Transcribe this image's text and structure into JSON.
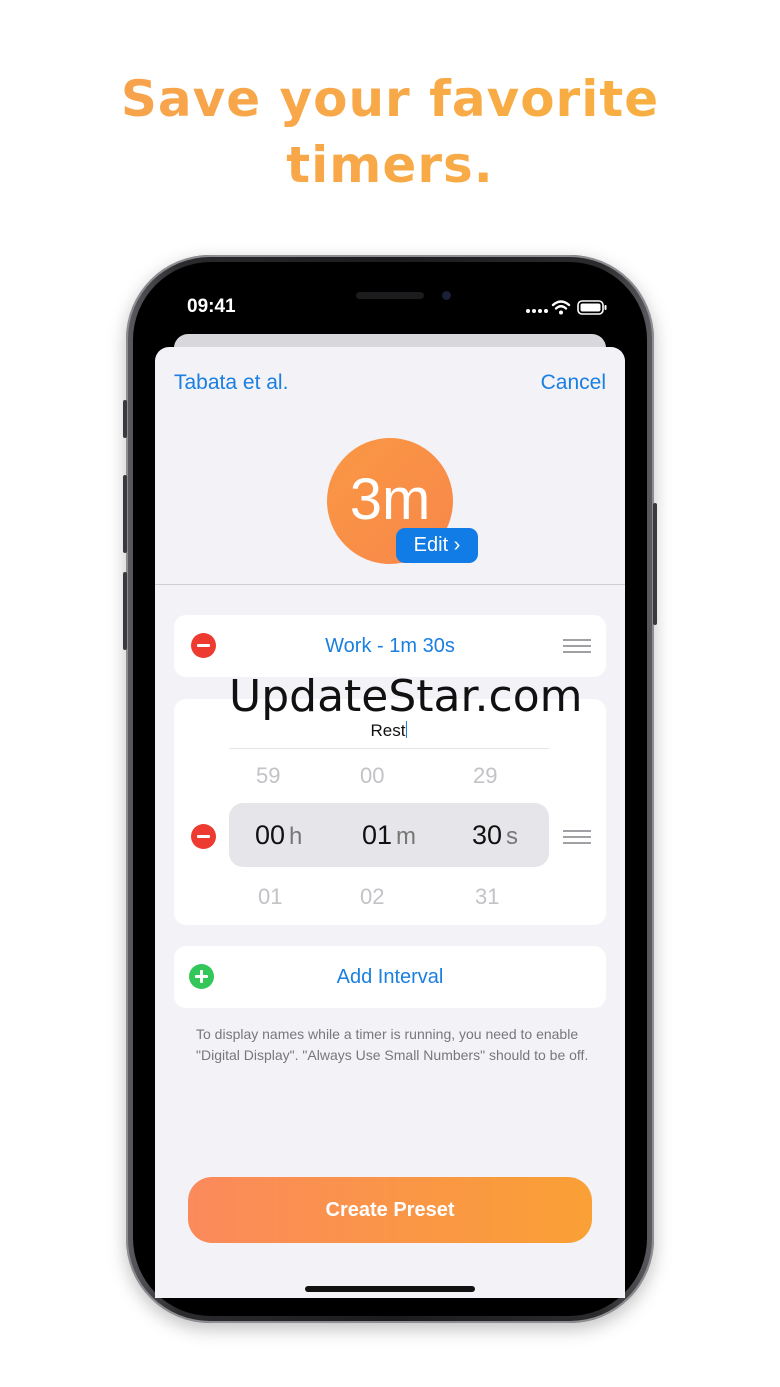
{
  "headline": {
    "line1": "Save your favorite",
    "line2": "timers."
  },
  "status_bar": {
    "time": "09:41"
  },
  "nav": {
    "title": "Tabata et al.",
    "cancel": "Cancel"
  },
  "timer": {
    "value": "3m",
    "edit_label": "Edit ›"
  },
  "intervals": [
    {
      "label": "Work - 1m 30s"
    },
    {
      "name": "Rest",
      "picker": {
        "above": [
          "59",
          "00",
          "29"
        ],
        "selected": [
          {
            "value": "00",
            "unit": "h"
          },
          {
            "value": "01",
            "unit": "m"
          },
          {
            "value": "30",
            "unit": "s"
          }
        ],
        "below": [
          "01",
          "02",
          "31"
        ]
      }
    }
  ],
  "add_interval": "Add Interval",
  "footnote": "To display names while a timer is running, you need to enable \"Digital Display\". \"Always Use Small Numbers\" should to be off.",
  "create_button": "Create Preset",
  "watermark": "UpdateStar.com",
  "colors": {
    "accent_orange": "#f9a04a",
    "link_blue": "#1a7fe0",
    "delete_red": "#ee3b31",
    "add_green": "#33c759"
  }
}
